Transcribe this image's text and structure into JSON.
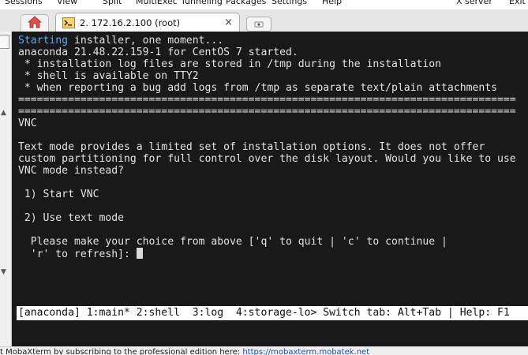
{
  "menu": {
    "items": [
      "Sessions",
      "View",
      "Split",
      "MultiExec",
      "Tunneling",
      "Packages",
      "Settings",
      "Help",
      "X server",
      "Exit"
    ]
  },
  "tabs": {
    "home_icon": "home-icon",
    "session_title": "2. 172.16.2.100 (root)",
    "close_glyph": "×"
  },
  "terminal": {
    "lines": [
      {
        "highlight": "Starting",
        "text": " installer, one moment..."
      },
      {
        "text": "anaconda 21.48.22.159-1 for CentOS 7 started."
      },
      {
        "text": " * installation log files are stored in /tmp during the installation"
      },
      {
        "text": " * shell is available on TTY2"
      },
      {
        "text": " * when reporting a bug add logs from /tmp as separate text/plain attachments"
      },
      {
        "text": "================================================================================"
      },
      {
        "text": "================================================================================"
      },
      {
        "text": "VNC"
      },
      {
        "text": ""
      },
      {
        "text": "Text mode provides a limited set of installation options. It does not offer"
      },
      {
        "text": "custom partitioning for full control over the disk layout. Would you like to use"
      },
      {
        "text": "VNC mode instead?"
      },
      {
        "text": ""
      },
      {
        "text": " 1) Start VNC"
      },
      {
        "text": ""
      },
      {
        "text": " 2) Use text mode"
      },
      {
        "text": ""
      },
      {
        "text": "  Please make your choice from above ['q' to quit | 'c' to continue |"
      },
      {
        "text": "  'r' to refresh]: "
      }
    ],
    "status_bar": "[anaconda] 1:main* 2:shell  3:log  4:storage-lo> Switch tab: Alt+Tab | Help: F1"
  },
  "bottom": {
    "promo_text": "t MobaXterm by subscribing to the professional edition here:  ",
    "promo_link": "https://mobaxterm.mobatek.net"
  },
  "colors": {
    "terminal_bg": "#191919",
    "terminal_fg": "#e2e2e2",
    "highlight": "#5fa7ee"
  }
}
